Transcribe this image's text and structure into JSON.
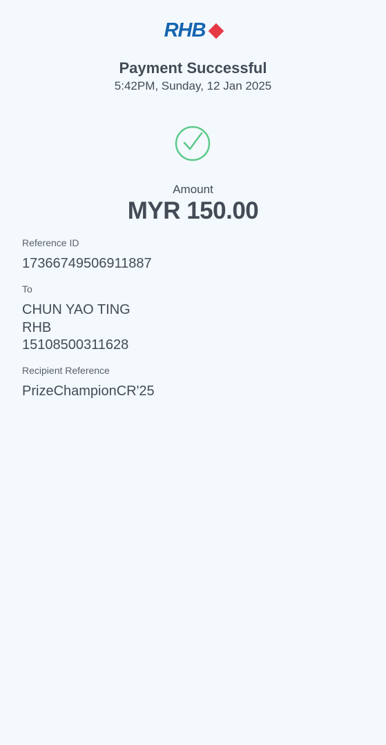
{
  "logo": {
    "text": "RHB"
  },
  "header": {
    "title": "Payment Successful",
    "datetime": "5:42PM, Sunday, 12 Jan 2025"
  },
  "status_icon": "check-circle-icon",
  "amount": {
    "label": "Amount",
    "value": "MYR 150.00"
  },
  "details": {
    "reference_id": {
      "label": "Reference ID",
      "value": "17366749506911887"
    },
    "to": {
      "label": "To",
      "name": "CHUN YAO TING",
      "bank": "RHB",
      "account": "15108500311628"
    },
    "recipient_reference": {
      "label": "Recipient Reference",
      "value": "PrizeChampionCR'25"
    }
  },
  "colors": {
    "background": "#f3f9fc",
    "brand_blue": "#1565b0",
    "brand_red": "#e63946",
    "success_green": "#5cc98a",
    "text": "#444b56"
  }
}
